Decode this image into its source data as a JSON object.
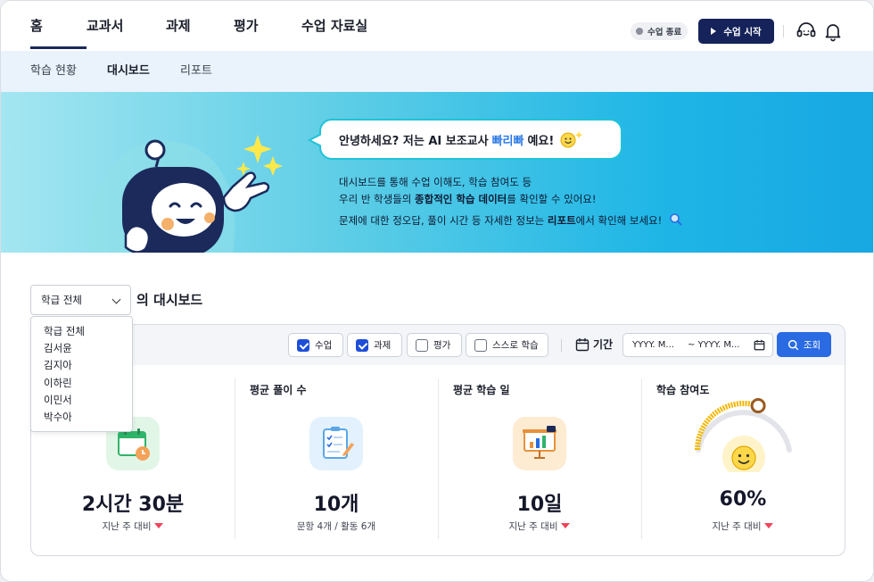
{
  "topnav": {
    "menu": [
      "홈",
      "교과서",
      "과제",
      "평가",
      "수업 자료실"
    ],
    "active_index": 0,
    "status_label": "수업 종료",
    "start_label": "수업 시작"
  },
  "subnav": {
    "items": [
      "학습 현황",
      "대시보드",
      "리포트"
    ],
    "active_index": 1
  },
  "banner": {
    "bubble_prefix": "안녕하세요? 저는 AI 보조교사",
    "bubble_name": "빠리빠",
    "bubble_suffix": "예요!",
    "line1": "대시보드를 통해 수업 이해도, 학습 참여도 등",
    "line2_a": "우리 반 학생들의",
    "line2_b": "종합적인 학습 데이터",
    "line2_c": "를 확인할 수 있어요!",
    "line3_a": "문제에 대한 정오답, 풀이 시간 등 자세한 정보는",
    "line3_b": "리포트",
    "line3_c": "에서 확인해 보세요!"
  },
  "dashboard": {
    "class_select_value": "학급 전체",
    "title": "의 대시보드",
    "class_options": [
      "학급 전체",
      "김서윤",
      "김지아",
      "이하린",
      "이민서",
      "박수아"
    ]
  },
  "filters": {
    "chips": [
      {
        "label": "수업",
        "checked": true
      },
      {
        "label": "과제",
        "checked": true
      },
      {
        "label": "평가",
        "checked": false
      },
      {
        "label": "스스로 학습",
        "checked": false
      }
    ],
    "period_label": "기간",
    "date_start_placeholder": "YYYY. M...",
    "date_end_placeholder": "~ YYYY. M...",
    "search_label": "조회"
  },
  "stats": [
    {
      "title": "",
      "value": "2시간 30분",
      "sub": "지난 주 대비",
      "trend": "down"
    },
    {
      "title": "평균 풀이 수",
      "value": "10개",
      "sub": "문항 4개 / 활동 6개",
      "trend": ""
    },
    {
      "title": "평균 학습 일",
      "value": "10일",
      "sub": "지난 주 대비",
      "trend": "down"
    },
    {
      "title": "학습 참여도",
      "value": "60%",
      "sub": "지난 주 대비",
      "trend": "down",
      "gauge_fraction": 0.6
    }
  ],
  "colors": {
    "nav_dark": "#16235a",
    "accent_blue": "#2a6be3",
    "trend_down": "#f0445a",
    "gauge_fill": "#f2b705"
  }
}
